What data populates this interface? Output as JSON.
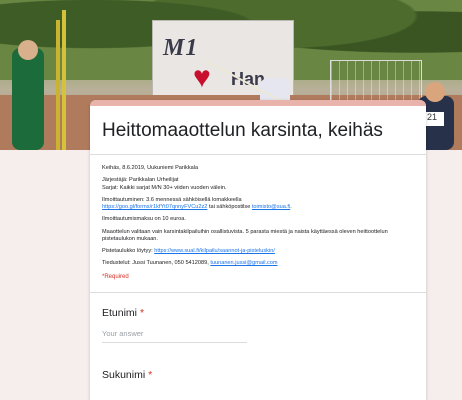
{
  "banner": {
    "sign_text": "M1",
    "sign_text2": "Han",
    "bib_number": "21"
  },
  "form": {
    "title": "Heittomaaottelun karsinta, keihäs",
    "description": {
      "line1": "Keihäs, 8.6.2019, Uukuniemi Parikkala",
      "line2": "Järjestäjä: Parikkalan Urheilijat",
      "line3": "Sarjat: Kaikki sarjat M/N 30+ viiden vuoden välein.",
      "line4": "Ilmoittautuminen: 3.6 mennessä sähköisellä lomakkeella",
      "line5_link": "https://goo.gl/forms/r1kfYt07qnnyFVCu2z2",
      "line5_mid": " tai sähköpostilse ",
      "line5_link2": "toimisto@sua.fi",
      "line5_end": ".",
      "line6": "Ilmoittautumismaksu on 10 euroa.",
      "line7": "Maaottelun valitaan vain karsintakilpailuihin osallistuvista. 5 parasta miestä ja naista käyttäessä oleven heittoottelun pistetaulukon mukaan.",
      "line8_prefix": "Pistetaulukko löytyy: ",
      "line8_link": "https://www.sual.fi/kilpailu/saannot-ja-pisteluskin/",
      "line9_prefix": "Tiedustelut: Jussi Tuunanen, 050 5412089, ",
      "line9_link": "tuunanen.jussi@gmail.com"
    },
    "required_note": "*Required",
    "questions": [
      {
        "label": "Etunimi",
        "required_mark": "*",
        "placeholder": "Your answer"
      },
      {
        "label": "Sukunimi",
        "required_mark": "*"
      }
    ]
  },
  "colors": {
    "accent": "#e7b3aa",
    "required": "#d93025",
    "link": "#1a73e8"
  }
}
